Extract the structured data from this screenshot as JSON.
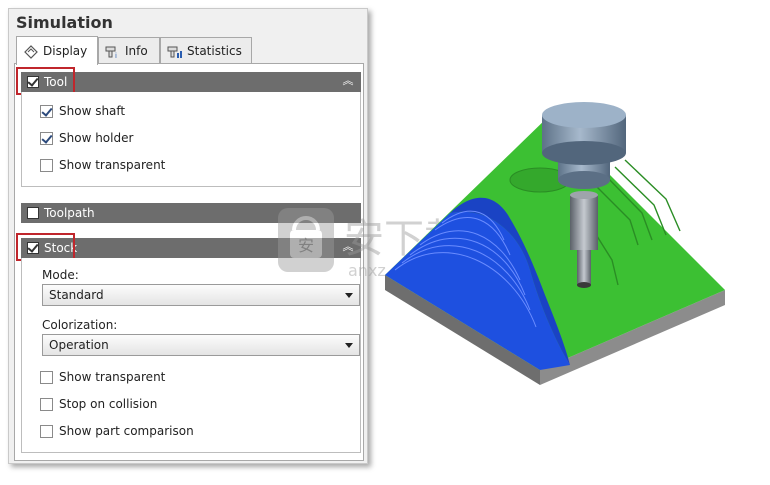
{
  "panel": {
    "title": "Simulation",
    "tabs": [
      {
        "label": "Display",
        "icon": "display-tool-icon",
        "active": true
      },
      {
        "label": "Info",
        "icon": "info-tool-icon",
        "active": false
      },
      {
        "label": "Statistics",
        "icon": "statistics-tool-icon",
        "active": false
      }
    ],
    "sections": {
      "tool": {
        "label": "Tool",
        "checked": true,
        "options": [
          {
            "label": "Show shaft",
            "checked": true
          },
          {
            "label": "Show holder",
            "checked": true
          },
          {
            "label": "Show transparent",
            "checked": false
          }
        ]
      },
      "toolpath": {
        "label": "Toolpath",
        "checked": false
      },
      "stock": {
        "label": "Stock",
        "checked": true,
        "mode_label": "Mode:",
        "mode_value": "Standard",
        "colorization_label": "Colorization:",
        "colorization_value": "Operation",
        "options": [
          {
            "label": "Show transparent",
            "checked": false
          },
          {
            "label": "Stop on collision",
            "checked": false
          },
          {
            "label": "Show part comparison",
            "checked": false
          }
        ]
      }
    }
  },
  "colors": {
    "section_header": "#6d6d6d",
    "highlight": "#c0262c",
    "stock_green": "#3cc033",
    "stock_blue": "#1e50e0",
    "tool_gray": "#7a8fa6"
  },
  "watermark": {
    "text": "安下载",
    "subtext": "anxz.com"
  }
}
